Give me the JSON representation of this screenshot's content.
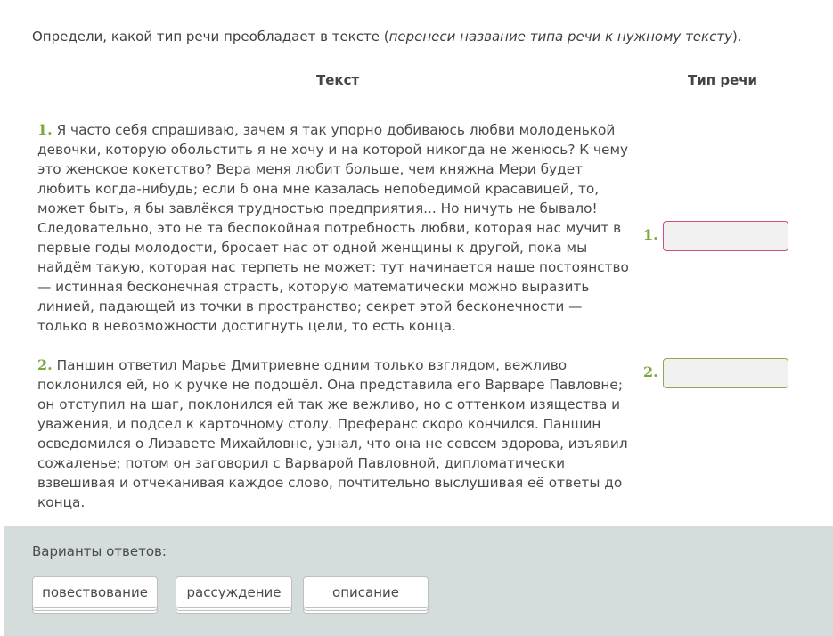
{
  "instruction": {
    "main": "Определи, какой тип речи преобладает в тексте (",
    "italic": "перенеси название типа речи к нужному тексту",
    "tail": ")."
  },
  "headers": {
    "text": "Текст",
    "type": "Тип речи"
  },
  "passages": [
    {
      "number": "1.",
      "text": " Я часто себя спрашиваю, зачем я так упорно добиваюсь любви молоденькой девочки, которую обольстить я не хочу и на которой никогда не женюсь? К чему это женское кокетство? Вера меня любит больше, чем княжна Мери будет любить когда-нибудь; если б она мне казалась непобедимой красавицей, то, может быть, я бы завлёкся трудностью предприятия... Но ничуть не бывало! Следовательно, это не та беспокойная потребность любви, которая нас мучит в первые годы молодости, бросает нас от одной женщины к другой, пока мы найдём такую, которая нас терпеть не может: тут начинается наше постоянство — истинная бесконечная страсть, которую математически можно выразить линией, падающей из точки в пространство; секрет этой бесконечности — только в невозможности достигнуть цели, то есть конца."
    },
    {
      "number": "2.",
      "text": " Паншин ответил Марье Дмитриевне одним только взглядом, вежливо поклонился ей, но к ручке не подошёл. Она представила его Варваре Павловне; он отступил на шаг, поклонился ей так же вежливо, но с оттенком изящества и уважения, и подсел к карточному столу. Преферанс скоро кончился. Паншин осведомился о Лизавете Михайловне, узнал, что она не совсем здорова, изъявил сожаленье; потом он заговорил с Варварой Павловной, дипломатически взвешивая и отчеканивая каждое слово, почтительно выслушивая её ответы до конца."
    }
  ],
  "slots": [
    {
      "number": "1.",
      "accent": "#c94f86"
    },
    {
      "number": "2.",
      "accent": "#89ad4d"
    }
  ],
  "answers": {
    "label": "Варианты ответов:",
    "options": [
      "повествование",
      "рассуждение",
      "описание"
    ]
  },
  "colors": {
    "number_green": "#7aa83a",
    "answers_bg": "#d4dcdc"
  }
}
